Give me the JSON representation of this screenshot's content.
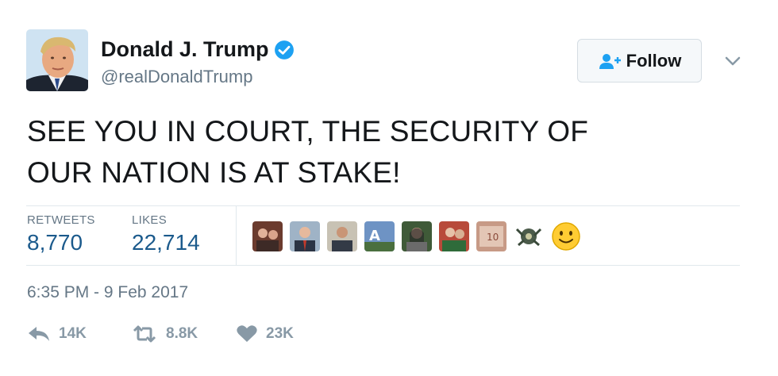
{
  "user": {
    "display_name": "Donald J. Trump",
    "handle": "@realDonaldTrump",
    "verified": true
  },
  "follow_button": {
    "label": "Follow"
  },
  "tweet": {
    "text_line1": "SEE YOU IN COURT, THE SECURITY OF",
    "text_line2": "OUR NATION IS AT STAKE!"
  },
  "stats": {
    "retweets_label": "RETWEETS",
    "retweets_value": "8,770",
    "likes_label": "LIKES",
    "likes_value": "22,714"
  },
  "likers": [
    "liker-avatar-1",
    "liker-avatar-2",
    "liker-avatar-3",
    "liker-avatar-4",
    "liker-avatar-5",
    "liker-avatar-6",
    "liker-avatar-7",
    "liker-avatar-8",
    "liker-avatar-9"
  ],
  "timestamp": "6:35 PM - 9 Feb 2017",
  "actions": {
    "reply_count": "14K",
    "retweet_count": "8.8K",
    "like_count": "23K"
  },
  "colors": {
    "verified_blue": "#1da1f2",
    "stat_value_blue": "#1b5a8c",
    "muted_gray": "#657786",
    "action_gray": "#8899a6"
  }
}
